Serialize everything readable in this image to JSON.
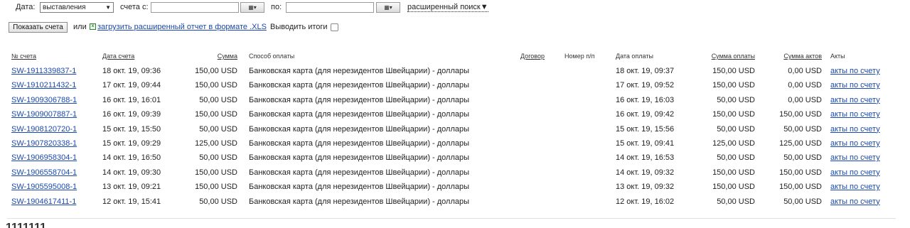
{
  "filter": {
    "date_label": "Дата:",
    "date_type_value": "выставления",
    "invoices_from_label": "счета с:",
    "from_value": "",
    "to_label": "по:",
    "to_value": "",
    "calendar_btn": "▦▾",
    "advanced_search_label": "расширенный поиск▼"
  },
  "actions": {
    "show_button": "Показать счета",
    "or_label": "или",
    "xls_icon": "x",
    "xls_link": "загрузить расширенный отчет в формате .XLS",
    "totals_label": "Выводить итоги"
  },
  "table": {
    "headers": {
      "no": "№ счета",
      "date": "Дата счета",
      "sum": "Сумма",
      "payment": "Способ оплаты",
      "contract": "Договор",
      "nomer": "Номер п/п",
      "pay_date": "Дата оплаты",
      "pay_sum": "Сумма оплаты",
      "acts_sum": "Сумма актов",
      "acts": "Акты"
    },
    "rows": [
      {
        "no": "SW-1911339837-1",
        "date": "18 окт. 19, 09:36",
        "sum": "150,00 USD",
        "payment": "Банковская карта (для нерезидентов Швейцарии) - доллары",
        "contract": "",
        "nomer": "",
        "pay_date": "18 окт. 19, 09:37",
        "pay_sum": "150,00 USD",
        "acts_sum": "0,00 USD",
        "acts": "акты по счету"
      },
      {
        "no": "SW-1910211432-1",
        "date": "17 окт. 19, 09:44",
        "sum": "150,00 USD",
        "payment": "Банковская карта (для нерезидентов Швейцарии) - доллары",
        "contract": "",
        "nomer": "",
        "pay_date": "17 окт. 19, 09:52",
        "pay_sum": "150,00 USD",
        "acts_sum": "0,00 USD",
        "acts": "акты по счету"
      },
      {
        "no": "SW-1909306788-1",
        "date": "16 окт. 19, 16:01",
        "sum": "50,00 USD",
        "payment": "Банковская карта (для нерезидентов Швейцарии) - доллары",
        "contract": "",
        "nomer": "",
        "pay_date": "16 окт. 19, 16:03",
        "pay_sum": "50,00 USD",
        "acts_sum": "0,00 USD",
        "acts": "акты по счету"
      },
      {
        "no": "SW-1909007887-1",
        "date": "16 окт. 19, 09:39",
        "sum": "150,00 USD",
        "payment": "Банковская карта (для нерезидентов Швейцарии) - доллары",
        "contract": "",
        "nomer": "",
        "pay_date": "16 окт. 19, 09:42",
        "pay_sum": "150,00 USD",
        "acts_sum": "150,00 USD",
        "acts": "акты по счету"
      },
      {
        "no": "SW-1908120720-1",
        "date": "15 окт. 19, 15:50",
        "sum": "50,00 USD",
        "payment": "Банковская карта (для нерезидентов Швейцарии) - доллары",
        "contract": "",
        "nomer": "",
        "pay_date": "15 окт. 19, 15:56",
        "pay_sum": "50,00 USD",
        "acts_sum": "50,00 USD",
        "acts": "акты по счету"
      },
      {
        "no": "SW-1907820338-1",
        "date": "15 окт. 19, 09:29",
        "sum": "125,00 USD",
        "payment": "Банковская карта (для нерезидентов Швейцарии) - доллары",
        "contract": "",
        "nomer": "",
        "pay_date": "15 окт. 19, 09:41",
        "pay_sum": "125,00 USD",
        "acts_sum": "125,00 USD",
        "acts": "акты по счету"
      },
      {
        "no": "SW-1906958304-1",
        "date": "14 окт. 19, 16:50",
        "sum": "50,00 USD",
        "payment": "Банковская карта (для нерезидентов Швейцарии) - доллары",
        "contract": "",
        "nomer": "",
        "pay_date": "14 окт. 19, 16:53",
        "pay_sum": "50,00 USD",
        "acts_sum": "50,00 USD",
        "acts": "акты по счету"
      },
      {
        "no": "SW-1906558704-1",
        "date": "14 окт. 19, 09:30",
        "sum": "150,00 USD",
        "payment": "Банковская карта (для нерезидентов Швейцарии) - доллары",
        "contract": "",
        "nomer": "",
        "pay_date": "14 окт. 19, 09:32",
        "pay_sum": "150,00 USD",
        "acts_sum": "150,00 USD",
        "acts": "акты по счету"
      },
      {
        "no": "SW-1905595008-1",
        "date": "13 окт. 19, 09:21",
        "sum": "150,00 USD",
        "payment": "Банковская карта (для нерезидентов Швейцарии) - доллары",
        "contract": "",
        "nomer": "",
        "pay_date": "13 окт. 19, 09:32",
        "pay_sum": "150,00 USD",
        "acts_sum": "150,00 USD",
        "acts": "акты по счету"
      },
      {
        "no": "SW-1904617411-1",
        "date": "12 окт. 19, 15:41",
        "sum": "50,00 USD",
        "payment": "Банковская карта (для нерезидентов Швейцарии) - доллары",
        "contract": "",
        "nomer": "",
        "pay_date": "12 окт. 19, 16:02",
        "pay_sum": "50,00 USD",
        "acts_sum": "50,00 USD",
        "acts": "акты по счету"
      }
    ]
  },
  "footer": {
    "cut_text": "1111111"
  }
}
